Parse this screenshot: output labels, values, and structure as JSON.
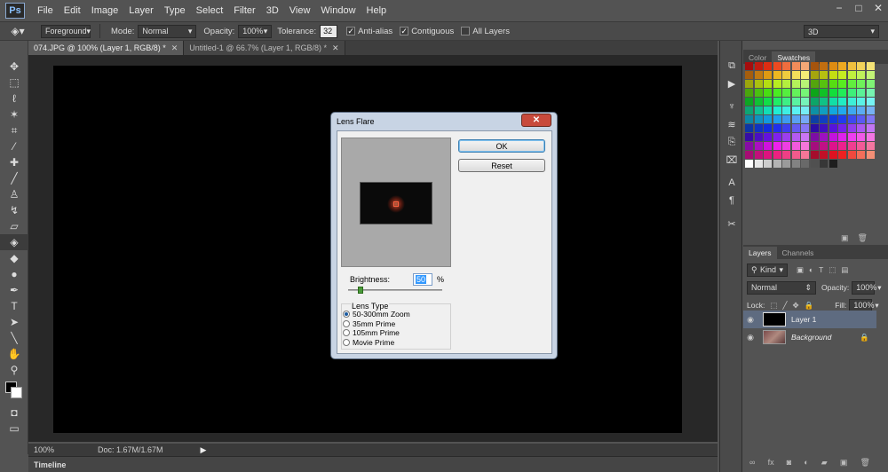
{
  "app": {
    "logo": "Ps"
  },
  "menu": [
    "File",
    "Edit",
    "Image",
    "Layer",
    "Type",
    "Select",
    "Filter",
    "3D",
    "View",
    "Window",
    "Help"
  ],
  "window_controls": [
    "−",
    "□",
    "✕"
  ],
  "options": {
    "preset": "Foreground",
    "mode_label": "Mode:",
    "mode_value": "Normal",
    "opacity_label": "Opacity:",
    "opacity_value": "100%",
    "tolerance_label": "Tolerance:",
    "tolerance_value": "32",
    "antialias": "Anti-alias",
    "contiguous": "Contiguous",
    "all_layers": "All Layers",
    "workspace": "3D"
  },
  "doc_tabs": [
    {
      "label": "074.JPG @ 100% (Layer 1, RGB/8) *",
      "active": true
    },
    {
      "label": "Untitled-1 @ 66.7% (Layer 1, RGB/8) *",
      "active": false
    }
  ],
  "status": {
    "zoom": "100%",
    "doc": "Doc: 1.67M/1.67M"
  },
  "timeline_label": "Timeline",
  "panels": {
    "color_tab": "Color",
    "swatches_tab": "Swatches",
    "layers_tab": "Layers",
    "channels_tab": "Channels",
    "kind_label": "Kind",
    "blend_mode": "Normal",
    "opacity_label": "Opacity:",
    "opacity_value": "100%",
    "lock_label": "Lock:",
    "fill_label": "Fill:",
    "fill_value": "100%",
    "layers": [
      {
        "name": "Layer 1",
        "selected": true
      },
      {
        "name": "Background",
        "selected": false
      }
    ]
  },
  "dialog": {
    "title": "Lens Flare",
    "close": "✕",
    "ok": "OK",
    "reset": "Reset",
    "brightness_label": "Brightness:",
    "brightness_value": "50",
    "percent": "%",
    "lens_type_label": "Lens Type",
    "lens_options": [
      {
        "label": "50-300mm Zoom",
        "selected": true
      },
      {
        "label": "35mm Prime",
        "selected": false
      },
      {
        "label": "105mm Prime",
        "selected": false
      },
      {
        "label": "Movie Prime",
        "selected": false
      }
    ]
  }
}
